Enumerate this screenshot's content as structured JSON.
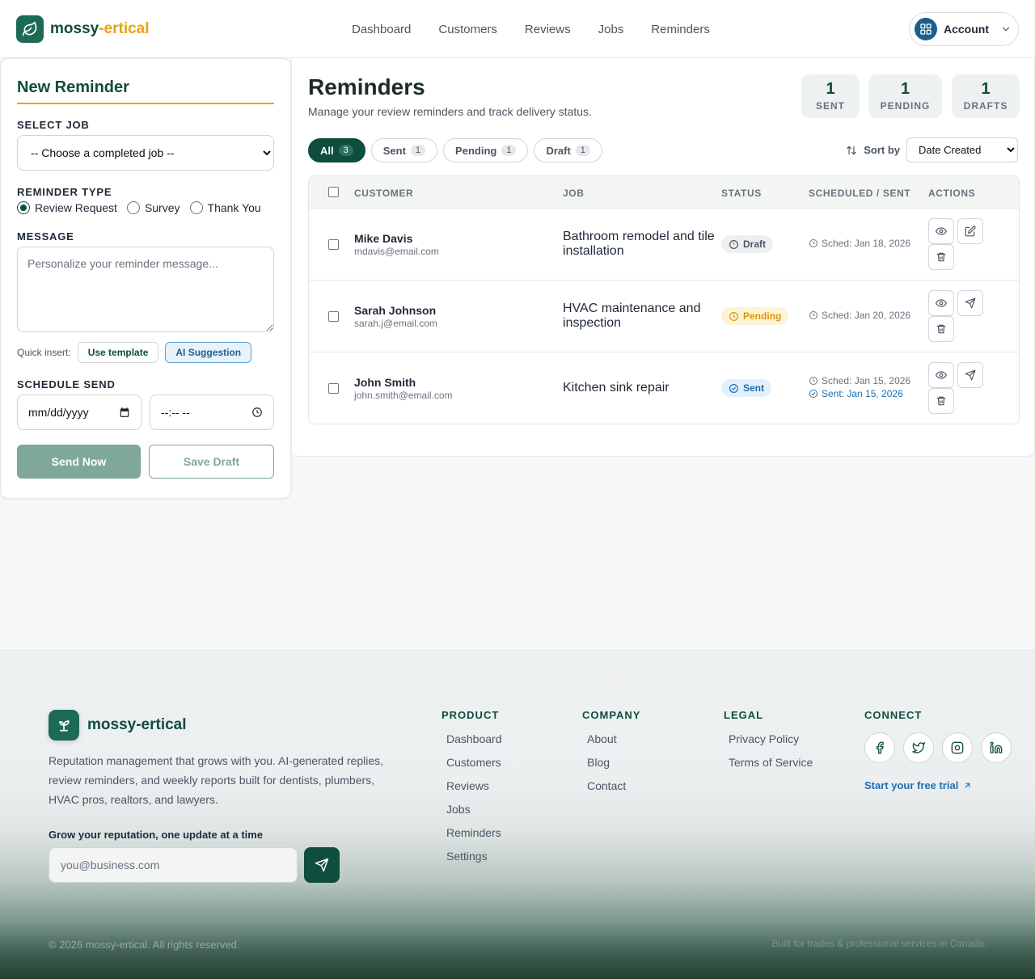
{
  "header": {
    "brand_main": "mossy",
    "brand_accent": "-ertical",
    "nav": [
      "Dashboard",
      "Customers",
      "Reviews",
      "Jobs",
      "Reminders"
    ],
    "account_label": "Account"
  },
  "form": {
    "title": "New Reminder",
    "select_job_label": "SELECT JOB",
    "select_job_value": "-- Choose a completed job --",
    "reminder_type_label": "REMINDER TYPE",
    "reminder_types": [
      "Review Request",
      "Survey",
      "Thank You"
    ],
    "selected_type": "Review Request",
    "message_label": "MESSAGE",
    "message_placeholder": "Personalize your reminder message...",
    "quick_insert_label": "Quick insert:",
    "use_template": "Use template",
    "ai_suggestion": "AI Suggestion",
    "schedule_label": "SCHEDULE SEND",
    "date_placeholder": "mm/dd/yyyy",
    "time_placeholder": "--:-- --",
    "send_now": "Send Now",
    "save_draft": "Save Draft"
  },
  "main": {
    "title": "Reminders",
    "subtitle": "Manage your review reminders and track delivery status.",
    "stats": [
      {
        "value": "1",
        "label": "SENT"
      },
      {
        "value": "1",
        "label": "PENDING"
      },
      {
        "value": "1",
        "label": "DRAFTS"
      }
    ],
    "filters": [
      {
        "label": "All",
        "count": "3"
      },
      {
        "label": "Sent",
        "count": "1"
      },
      {
        "label": "Pending",
        "count": "1"
      },
      {
        "label": "Draft",
        "count": "1"
      }
    ],
    "sort_label": "Sort by",
    "sort_value": "Date Created",
    "columns": [
      "CUSTOMER",
      "JOB",
      "STATUS",
      "SCHEDULED / SENT",
      "ACTIONS"
    ],
    "rows": [
      {
        "name": "Mike Davis",
        "email": "mdavis@email.com",
        "job": "Bathroom remodel and tile installation",
        "status": "Draft",
        "sched": "Sched: Jan 18, 2026",
        "sent": ""
      },
      {
        "name": "Sarah Johnson",
        "email": "sarah.j@email.com",
        "job": "HVAC maintenance and inspection",
        "status": "Pending",
        "sched": "Sched: Jan 20, 2026",
        "sent": ""
      },
      {
        "name": "John Smith",
        "email": "john.smith@email.com",
        "job": "Kitchen sink repair",
        "status": "Sent",
        "sched": "Sched: Jan 15, 2026",
        "sent": "Sent: Jan 15, 2026"
      }
    ]
  },
  "footer": {
    "brand": "mossy-ertical",
    "description": "Reputation management that grows with you. AI-generated replies, review reminders, and weekly reports built for dentists, plumbers, HVAC pros, realtors, and lawyers.",
    "grow_label": "Grow your reputation, one update at a time",
    "email_placeholder": "you@business.com",
    "product_title": "PRODUCT",
    "product_links": [
      "Dashboard",
      "Customers",
      "Reviews",
      "Jobs",
      "Reminders",
      "Settings"
    ],
    "company_title": "COMPANY",
    "company_links": [
      "About",
      "Blog",
      "Contact"
    ],
    "legal_title": "LEGAL",
    "legal_links": [
      "Privacy Policy",
      "Terms of Service"
    ],
    "connect_title": "CONNECT",
    "social_icons": [
      "facebook-icon",
      "twitter-icon",
      "instagram-icon",
      "linkedin-icon"
    ],
    "trial_link": "Start your free trial",
    "copyright": "© 2026 mossy-ertical. All rights reserved.",
    "built_for": "Built for trades & professional services in Canada."
  },
  "colors": {
    "brand_green": "#0f4d3e",
    "accent_orange": "#e8a317",
    "link_blue": "#1c6fb5"
  }
}
